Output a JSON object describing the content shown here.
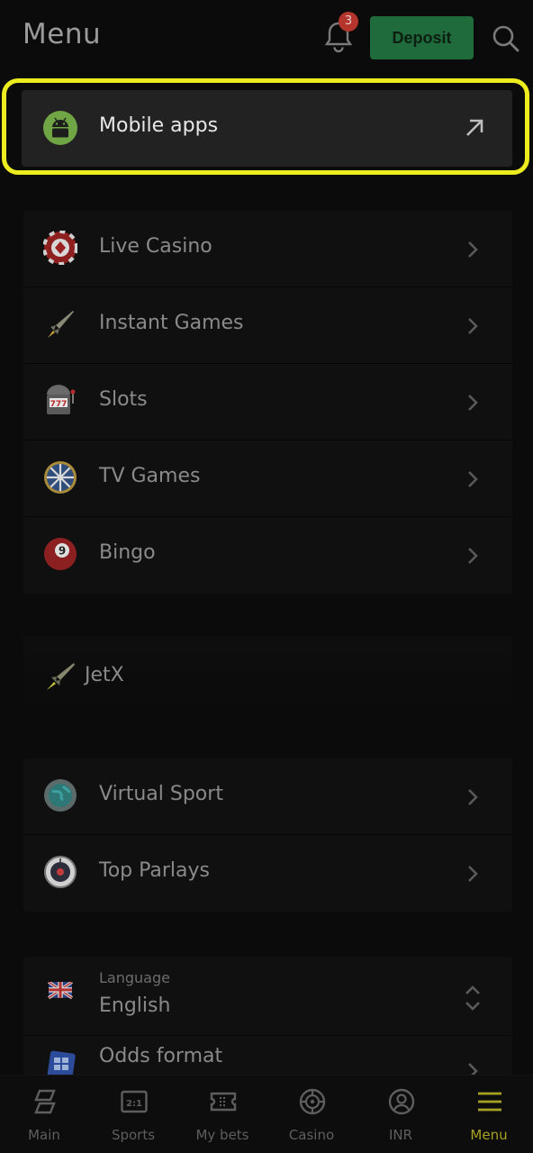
{
  "header": {
    "title": "Menu",
    "notification_count": "3",
    "deposit_label": "Deposit"
  },
  "mobile_apps": {
    "label": "Mobile apps",
    "icon": "android-icon"
  },
  "games": [
    {
      "label": "Live Casino",
      "icon": "casino-chip-icon"
    },
    {
      "label": "Instant Games",
      "icon": "rocket-icon"
    },
    {
      "label": "Slots",
      "icon": "slot-machine-icon"
    },
    {
      "label": "TV Games",
      "icon": "wheel-icon"
    },
    {
      "label": "Bingo",
      "icon": "billiard-ball-icon"
    }
  ],
  "jetx": {
    "label": "JetX",
    "icon": "jet-icon"
  },
  "sports": [
    {
      "label": "Virtual Sport",
      "icon": "globe-icon"
    },
    {
      "label": "Top Parlays",
      "icon": "dial-icon"
    }
  ],
  "settings": {
    "language_caption": "Language",
    "language_value": "English",
    "odds_label": "Odds format"
  },
  "bottom_nav": [
    {
      "label": "Main",
      "icon": "main-icon"
    },
    {
      "label": "Sports",
      "icon": "sports-icon"
    },
    {
      "label": "My bets",
      "icon": "ticket-icon"
    },
    {
      "label": "Casino",
      "icon": "casino-icon"
    },
    {
      "label": "INR",
      "icon": "user-icon"
    },
    {
      "label": "Menu",
      "icon": "hamburger-icon",
      "active": true
    }
  ],
  "colors": {
    "highlight": "#ecec1e",
    "deposit": "#1f6b3b",
    "badge": "#b4352b",
    "active_nav": "#a7a221"
  }
}
